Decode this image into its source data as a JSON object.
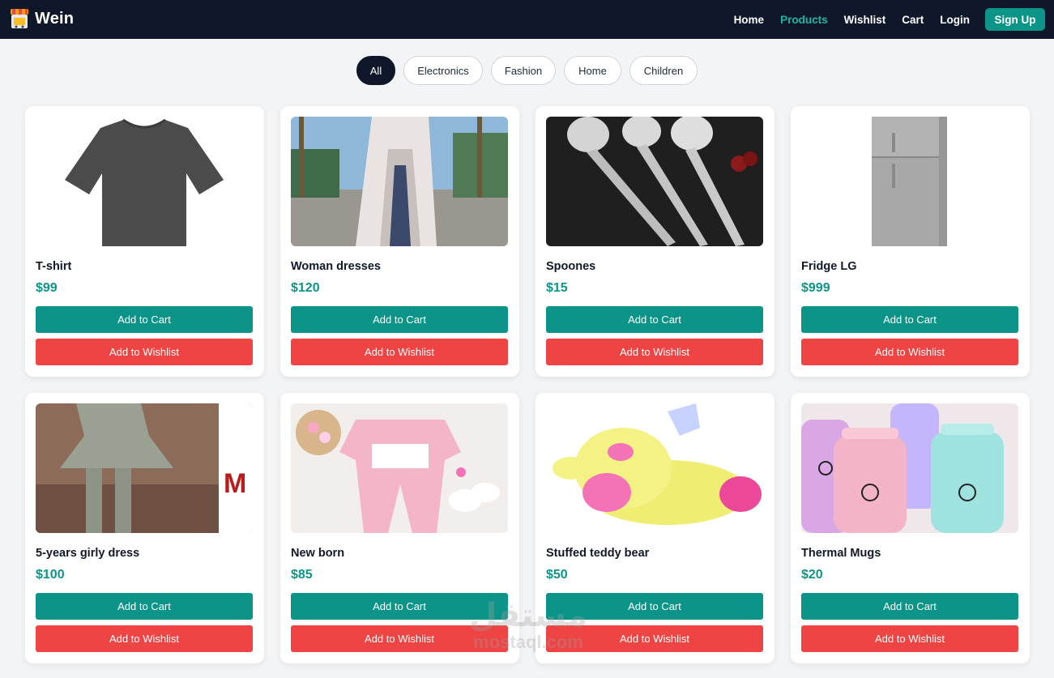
{
  "brand": {
    "name": "Wein",
    "logo_icon": "store-icon"
  },
  "nav": {
    "items": [
      {
        "label": "Home",
        "active": false
      },
      {
        "label": "Products",
        "active": true
      },
      {
        "label": "Wishlist",
        "active": false
      },
      {
        "label": "Cart",
        "active": false
      },
      {
        "label": "Login",
        "active": false
      }
    ],
    "signup_label": "Sign Up"
  },
  "filters": {
    "items": [
      {
        "label": "All",
        "active": true
      },
      {
        "label": "Electronics",
        "active": false
      },
      {
        "label": "Fashion",
        "active": false
      },
      {
        "label": "Home",
        "active": false
      },
      {
        "label": "Children",
        "active": false
      }
    ]
  },
  "products": [
    {
      "name": "T-shirt",
      "price": "$99",
      "cart_label": "Add to Cart",
      "wishlist_label": "Add to Wishlist"
    },
    {
      "name": "Woman dresses",
      "price": "$120",
      "cart_label": "Add to Cart",
      "wishlist_label": "Add to Wishlist"
    },
    {
      "name": "Spoones",
      "price": "$15",
      "cart_label": "Add to Cart",
      "wishlist_label": "Add to Wishlist"
    },
    {
      "name": "Fridge LG",
      "price": "$999",
      "cart_label": "Add to Cart",
      "wishlist_label": "Add to Wishlist"
    },
    {
      "name": "5-years girly dress",
      "price": "$100",
      "cart_label": "Add to Cart",
      "wishlist_label": "Add to Wishlist"
    },
    {
      "name": "New born",
      "price": "$85",
      "cart_label": "Add to Cart",
      "wishlist_label": "Add to Wishlist"
    },
    {
      "name": "Stuffed teddy bear",
      "price": "$50",
      "cart_label": "Add to Cart",
      "wishlist_label": "Add to Wishlist"
    },
    {
      "name": "Thermal Mugs",
      "price": "$20",
      "cart_label": "Add to Cart",
      "wishlist_label": "Add to Wishlist"
    }
  ],
  "watermark": {
    "arabic": "مستقل",
    "latin": "mostaql.com"
  },
  "colors": {
    "navbar": "#0f172a",
    "accent": "#0d9488",
    "accent_light": "#14b8a6",
    "danger": "#ef4444"
  }
}
